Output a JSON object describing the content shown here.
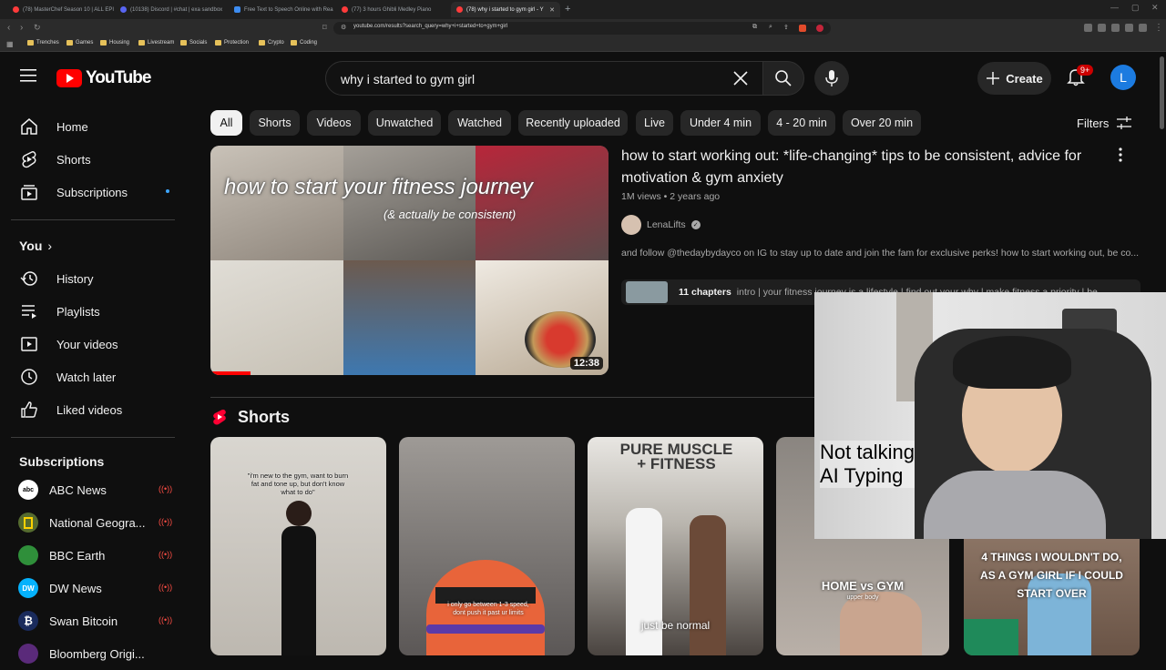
{
  "browser": {
    "tabs": [
      {
        "title": "(78) MasterChef Season 10 | ALL EPI"
      },
      {
        "title": "(10138) Discord | #chat | exa sandbox"
      },
      {
        "title": "Free Text to Speech Online with Rea"
      },
      {
        "title": "(77) 3 hours Ghibli Medley Piano"
      },
      {
        "title": "(78) why i started to gym girl - Y"
      }
    ],
    "url": "youtube.com/results?search_query=why+i+started+to+gym+girl",
    "bookmarks": [
      "Trenches",
      "Games",
      "Housing",
      "Livestream",
      "Socials",
      "Protection",
      "Crypto",
      "Coding"
    ]
  },
  "header": {
    "logo_text": "YouTube",
    "search_value": "why i started to gym girl",
    "create_label": "Create",
    "notification_count": "9+",
    "avatar_letter": "L",
    "brand_color": "#ff0000"
  },
  "sidebar": {
    "main": [
      {
        "label": "Home",
        "icon": "home-icon"
      },
      {
        "label": "Shorts",
        "icon": "shorts-icon"
      },
      {
        "label": "Subscriptions",
        "icon": "subscriptions-icon"
      }
    ],
    "you_label": "You",
    "you_items": [
      {
        "label": "History",
        "icon": "history-icon"
      },
      {
        "label": "Playlists",
        "icon": "playlists-icon"
      },
      {
        "label": "Your videos",
        "icon": "your-videos-icon"
      },
      {
        "label": "Watch later",
        "icon": "watch-later-icon"
      },
      {
        "label": "Liked videos",
        "icon": "liked-videos-icon"
      }
    ],
    "subscriptions_label": "Subscriptions",
    "subscriptions": [
      {
        "label": "ABC News",
        "avatar": "abc"
      },
      {
        "label": "National Geogra...",
        "avatar": ""
      },
      {
        "label": "BBC Earth",
        "avatar": ""
      },
      {
        "label": "DW News",
        "avatar": "DW"
      },
      {
        "label": "Swan Bitcoin",
        "avatar": "₿"
      },
      {
        "label": "Bloomberg Origi...",
        "avatar": ""
      }
    ]
  },
  "chips": [
    "All",
    "Shorts",
    "Videos",
    "Unwatched",
    "Watched",
    "Recently uploaded",
    "Live",
    "Under 4 min",
    "4 - 20 min",
    "Over 20 min"
  ],
  "filters_label": "Filters",
  "video": {
    "title": "how to start working out: *life-changing* tips to be consistent, advice for motivation & gym anxiety",
    "meta": "1M views • 2 years ago",
    "channel": "LenaLifts",
    "description": "and follow @thedaybydayco on IG to stay up to date and join the fam for exclusive perks! how to start working out, be co...",
    "chapters_count": "11 chapters",
    "chapters_text": "intro | your fitness journey is a lifestyle | find out your why | make fitness a priority | be...",
    "duration": "12:38",
    "watched_progress": 0.1,
    "thumb_title": "how to start your fitness journey",
    "thumb_subtitle": "(& actually be consistent)"
  },
  "shorts": {
    "heading": "Shorts",
    "items": [
      {
        "text": "\"i'm new to the gym, want to burn fat and tone up, but don't know what to do\""
      },
      {
        "text": "i only go between 1-3 speed, dont push it past ur limits"
      },
      {
        "text": "just be normal",
        "sign": "PURE MUSCLE + FITNESS"
      },
      {
        "text": "HOME vs GYM",
        "subtext": "upper body"
      },
      {
        "text": "4 THINGS I WOULDN'T DO, AS A GYM GIRL IF I COULD START OVER"
      }
    ]
  },
  "webcam": {
    "caption_line1": "Not talking",
    "caption_line2": "AI Typing"
  }
}
